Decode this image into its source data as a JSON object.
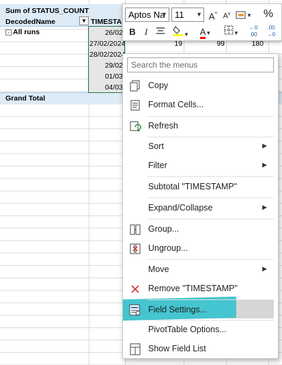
{
  "pivot": {
    "values_header": "Sum of STATUS_COUNT",
    "row_header": "DecodedName",
    "column_header": "TIMESTAMP",
    "group_label": "All runs",
    "grand_total_label": "Grand Total",
    "dates": [
      "26/02",
      "27/02/2024",
      "28/02/2024",
      "29/02",
      "01/03",
      "04/03"
    ],
    "visible_numbers": {
      "row2_col3": "19",
      "row2_col4": "99",
      "row2_col5": "180"
    },
    "header_color": "#ddebf7",
    "selection_color": "#217346"
  },
  "mini_toolbar": {
    "font_name": "Aptos Na",
    "font_size": "11",
    "grow_font_icon": "increase-font-size-icon",
    "shrink_font_icon": "decrease-font-size-icon",
    "number_format_icon": "number-format-icon",
    "percent": "%",
    "comma": ",",
    "bold": "B",
    "italic": "I",
    "font_color_letter": "A",
    "decimal_increase": "←0 .00",
    "decimal_decrease": ".00 →0",
    "fill_color": "#ffff00",
    "font_color": "#ff0000"
  },
  "context_menu": {
    "search_placeholder": "Search the menus",
    "items": [
      {
        "label": "Copy",
        "icon": "copy-icon"
      },
      {
        "label": "Format Cells...",
        "icon": "format-cells-icon"
      },
      {
        "label": "Refresh",
        "icon": "refresh-icon"
      },
      {
        "label": "Sort",
        "submenu": true
      },
      {
        "label": "Filter",
        "submenu": true
      },
      {
        "label": "Subtotal \"TIMESTAMP\""
      },
      {
        "label": "Expand/Collapse",
        "submenu": true
      },
      {
        "label": "Group...",
        "icon": "group-icon"
      },
      {
        "label": "Ungroup...",
        "icon": "ungroup-icon"
      },
      {
        "label": "Move",
        "submenu": true
      },
      {
        "label": "Remove \"TIMESTAMP\"",
        "icon": "remove-x-icon"
      },
      {
        "label": "Field Settings...",
        "icon": "field-settings-icon",
        "highlighted": true
      },
      {
        "label": "PivotTable Options..."
      },
      {
        "label": "Show Field List",
        "icon": "field-list-icon"
      }
    ],
    "highlight_color": "#45c5cf"
  }
}
